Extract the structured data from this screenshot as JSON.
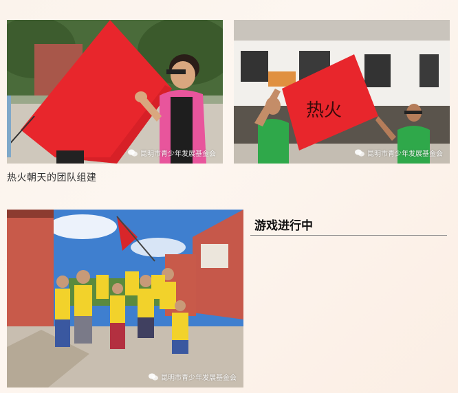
{
  "section1": {
    "caption": "热火朝天的团队组建"
  },
  "section2": {
    "heading": "游戏进行中"
  },
  "photo_watermark": "昆明市青少年发展基金会",
  "flag_text": "热火",
  "icons": {
    "watermark_icon": "wechat-icon"
  },
  "colors": {
    "flag_red": "#e8262c",
    "vest_pink": "#e7659a",
    "vest_green": "#2fa84a",
    "vest_yellow": "#f2d22b"
  }
}
